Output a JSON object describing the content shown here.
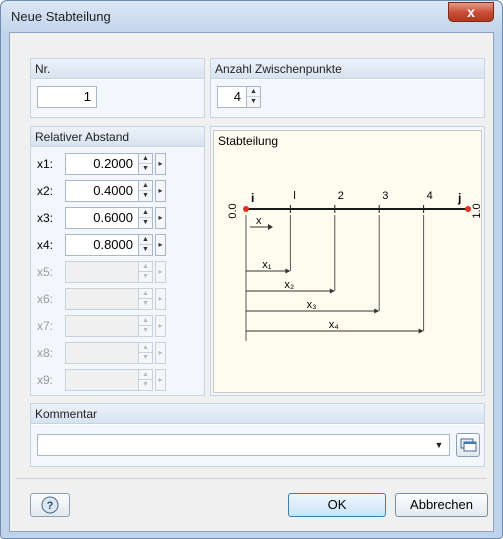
{
  "window": {
    "title": "Neue Stabteilung",
    "close_glyph": "x"
  },
  "nr": {
    "label": "Nr.",
    "value": "1"
  },
  "anzahl": {
    "label": "Anzahl Zwischenpunkte",
    "value": "4"
  },
  "relativ": {
    "label": "Relativer Abstand",
    "rows": [
      {
        "label": "x1:",
        "value": "0.2000",
        "enabled": true
      },
      {
        "label": "x2:",
        "value": "0.4000",
        "enabled": true
      },
      {
        "label": "x3:",
        "value": "0.6000",
        "enabled": true
      },
      {
        "label": "x4:",
        "value": "0.8000",
        "enabled": true
      },
      {
        "label": "x5:",
        "value": "",
        "enabled": false
      },
      {
        "label": "x6:",
        "value": "",
        "enabled": false
      },
      {
        "label": "x7:",
        "value": "",
        "enabled": false
      },
      {
        "label": "x8:",
        "value": "",
        "enabled": false
      },
      {
        "label": "x9:",
        "value": "",
        "enabled": false
      }
    ]
  },
  "diagram": {
    "title": "Stabteilung",
    "start_node": "i",
    "end_node": "j",
    "start_value": "0.0",
    "end_value": "1.0",
    "point_labels": [
      "l",
      "2",
      "3",
      "4"
    ],
    "axis_label": "x",
    "dimension_labels": [
      "x₁",
      "x₂",
      "x₃",
      "x₄"
    ],
    "colors": {
      "member": "#1a1a1a",
      "node": "#e03020",
      "background": "#fffcef"
    }
  },
  "kommentar": {
    "label": "Kommentar",
    "value": ""
  },
  "footer": {
    "ok_label": "OK",
    "cancel_label": "Abbrechen"
  }
}
